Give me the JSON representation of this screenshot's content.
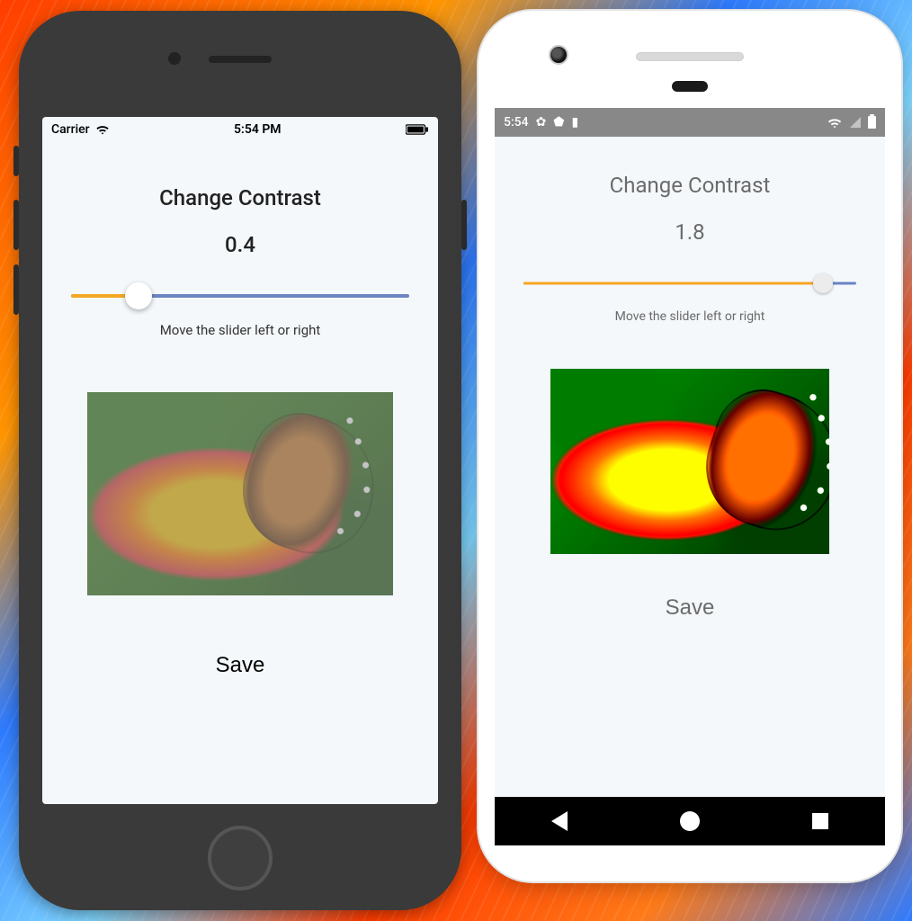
{
  "ios": {
    "status": {
      "carrier": "Carrier",
      "time": "5:54 PM"
    },
    "title": "Change Contrast",
    "value": "0.4",
    "hint": "Move the slider left or right",
    "save": "Save",
    "slider": {
      "min": 0,
      "max": 2,
      "value": 0.4,
      "percent": 20,
      "trackColor": "#6b85c4",
      "activeColor": "#f5a623"
    }
  },
  "android": {
    "status": {
      "time": "5:54"
    },
    "title": "Change Contrast",
    "value": "1.8",
    "hint": "Move the slider left or right",
    "save": "Save",
    "slider": {
      "min": 0,
      "max": 2,
      "value": 1.8,
      "percent": 90,
      "trackColor": "#6b85c4",
      "activeColor": "#f5a623"
    },
    "nav": {
      "back": "back",
      "home": "home",
      "recent": "recent"
    }
  }
}
